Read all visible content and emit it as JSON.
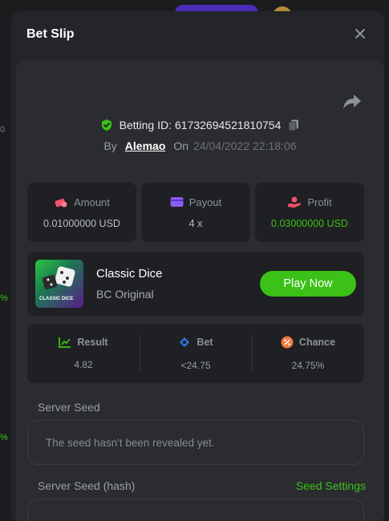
{
  "modal": {
    "title": "Bet Slip"
  },
  "bet": {
    "id_label": "Betting ID:",
    "id": "617326945218107​54",
    "by_label": "By",
    "user": "Alemao",
    "on_label": "On",
    "date": "24/04/2022 22:18:06"
  },
  "stats": [
    {
      "label": "Amount",
      "value": "0.01000000 USD",
      "icon": "amount-icon"
    },
    {
      "label": "Payout",
      "value": "4 x",
      "icon": "wallet-icon"
    },
    {
      "label": "Profit",
      "value": "0.03000000 USD",
      "icon": "profit-icon"
    }
  ],
  "game": {
    "name": "Classic Dice",
    "provider": "BC Original",
    "thumb_text": "CLASSIC DICE",
    "play_label": "Play Now"
  },
  "result_stats": [
    {
      "label": "Result",
      "value": "4.82",
      "icon": "result-icon"
    },
    {
      "label": "Bet",
      "value": "<24.75",
      "icon": "bet-icon"
    },
    {
      "label": "Chance",
      "value": "24.75%",
      "icon": "percent-icon"
    }
  ],
  "server_seed": {
    "label": "Server Seed",
    "value": "The seed hasn't been revealed yet."
  },
  "server_seed_hash": {
    "label": "Server Seed (hash)",
    "link": "Seed Settings"
  },
  "colors": {
    "accent": "#3bc117",
    "panel": "#2a2c30",
    "card": "#1e2023",
    "modal": "#232528"
  }
}
